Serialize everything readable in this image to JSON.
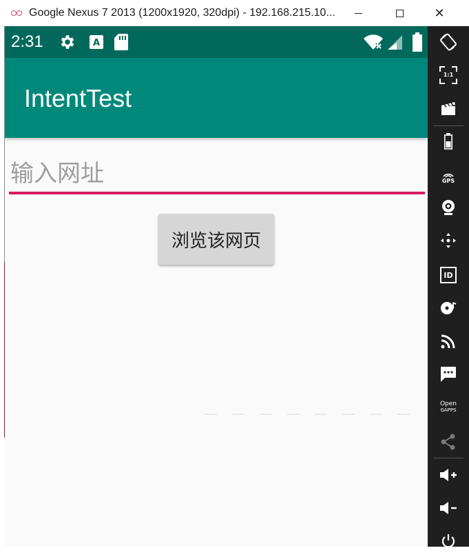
{
  "window": {
    "title": "Google Nexus 7 2013 (1200x1920, 320dpi) - 192.168.215.10...",
    "minimize_glyph": "",
    "close_glyph": "✕"
  },
  "status_bar": {
    "time": "2:31",
    "icons": [
      "settings-icon",
      "keyboard-a-icon",
      "sd-card-icon",
      "wifi-off-icon",
      "signal-icon",
      "battery-icon"
    ]
  },
  "app_bar": {
    "title": "IntentTest"
  },
  "form": {
    "url_placeholder": "输入网址",
    "url_value": "",
    "browse_button_label": "浏览该网页"
  },
  "sidebar": {
    "items": [
      {
        "icon": "rotate-icon"
      },
      {
        "icon": "fullscreen-1to1-icon",
        "label": "1:1"
      },
      {
        "icon": "screen-record-icon"
      },
      {
        "icon": "battery-icon"
      },
      {
        "icon": "gps-icon",
        "label": "GPS"
      },
      {
        "icon": "camera-icon"
      },
      {
        "icon": "move-dpad-icon"
      },
      {
        "icon": "device-id-icon",
        "label": "ID"
      },
      {
        "icon": "media-icon"
      },
      {
        "icon": "rss-icon"
      },
      {
        "icon": "sms-icon"
      },
      {
        "icon": "open-gapps-icon",
        "label": "Open",
        "label2": "GAPPS"
      },
      {
        "icon": "share-icon"
      },
      {
        "icon": "volume-up-icon"
      },
      {
        "icon": "volume-down-icon"
      },
      {
        "icon": "power-icon"
      }
    ]
  },
  "colors": {
    "status_bar": "#00695c",
    "app_bar": "#00897b",
    "accent": "#d81b60",
    "sidebar": "#1f1f1f"
  }
}
